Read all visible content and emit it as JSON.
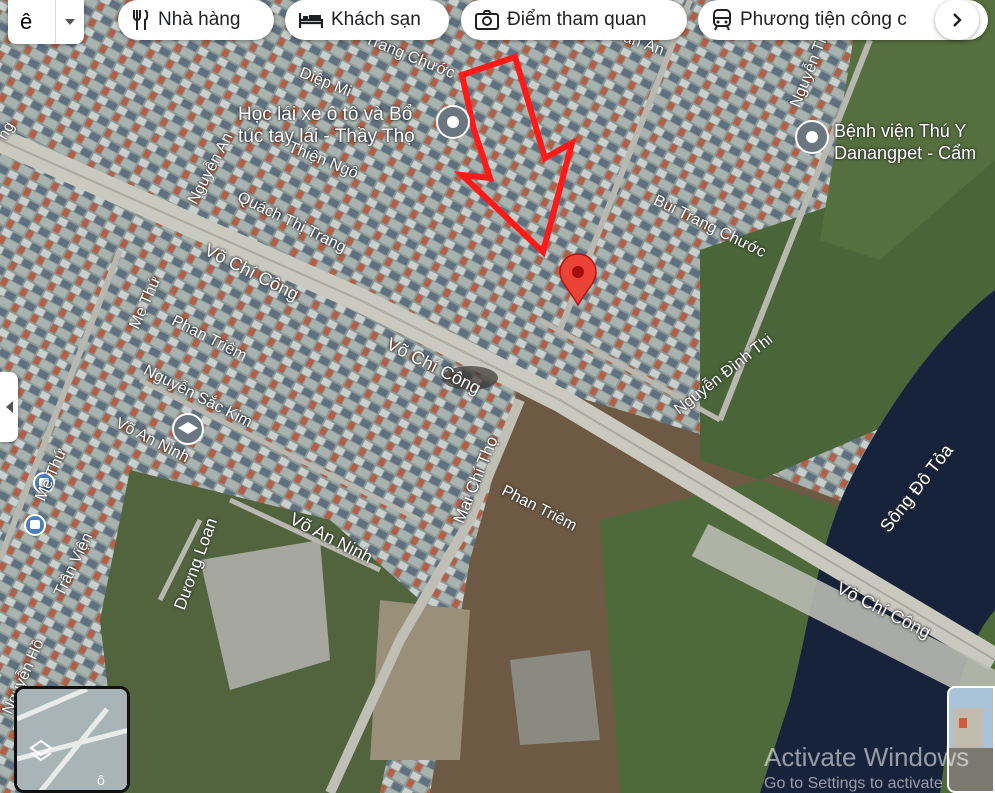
{
  "search": {
    "text": "ê"
  },
  "chips": [
    {
      "label": "Nhà hàng",
      "icon": "fork-knife-icon"
    },
    {
      "label": "Khách sạn",
      "icon": "bed-icon"
    },
    {
      "label": "Điểm tham quan",
      "icon": "camera-icon"
    },
    {
      "label": "Phương tiện công c",
      "icon": "train-icon"
    }
  ],
  "places": {
    "driving_school": "Học lái xe ô tô và Bổ\ntúc tay lái - Thầy Thọ",
    "vet_hospital": "Bệnh viện Thú Y\nDanangpet - Cẩm"
  },
  "streets": {
    "bui_trang_chuoc_top": "Trang Chước",
    "dien_an": "uân Ấn",
    "diep_minh": "Diệp Mi",
    "nguyen_thi_top": "Nguyễn Thị",
    "thien_ngo": "Thiện Ngô",
    "nguyen_an": "Nguyễn An",
    "quach_thi_trang": "Quách Thị Trang",
    "bui_trang_chuoc": "Bùi Trang Chước",
    "vo_chi_cong_1": "Võ Chí Công",
    "vo_chi_cong_2": "Võ Chí Công",
    "vo_chi_cong_3": "Võ Chí Công",
    "me_thu": "Mẹ Thứ",
    "me_thu_2": "Mẹ Thứ",
    "phan_triem_1": "Phan Triêm",
    "phan_triem_2": "Phan Triêm",
    "nguyen_sac_kim": "Nguyễn Sắc Kim",
    "vo_an_ninh_1": "Võ An Ninh",
    "vo_an_ninh_2": "Võ An Ninh",
    "nguyen_dinh_thi": "Nguyễn Đình Thi",
    "mai_chi_tho": "Mai Chí Thọ",
    "duong_loan": "Dương Loan",
    "tran_vien": "Trần Viện",
    "song_do_toa": "Sông Đô Tỏa",
    "left_edge": "ng",
    "nguyen_ho": "Nguyễn Hồ"
  },
  "watermark": {
    "line1": "Activate Windows",
    "line2": "Go to Settings to activate"
  },
  "layers": {
    "label": "ô"
  },
  "colors": {
    "pin": "#ea4335",
    "arrow": "#ff1a1a",
    "river": "#17233a",
    "urban": "#7a8a8c",
    "vegetation": "#4f6a3a"
  }
}
